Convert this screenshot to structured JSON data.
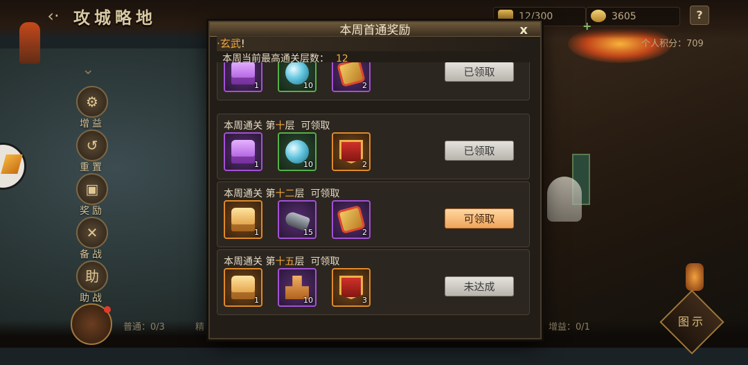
{
  "header": {
    "title": "攻城略地",
    "back_icon": "‹·",
    "resource_1": "12/300",
    "resource_2": "3605",
    "help_label": "?",
    "score": "个人积分：709"
  },
  "side_menu": [
    {
      "label": "增益",
      "icon": "gear-icon"
    },
    {
      "label": "重置",
      "icon": "reset-icon"
    },
    {
      "label": "奖励",
      "icon": "gift-icon"
    },
    {
      "label": "备战",
      "icon": "swords-icon"
    },
    {
      "label": "助战",
      "icon": "assist-icon",
      "glyph": "助"
    }
  ],
  "bottom": {
    "status_normal": "普通：0/3",
    "status_elite": "精",
    "status_buff": "增益：0/1",
    "map_button": "图示"
  },
  "modal": {
    "title": "本周首通奖励",
    "close": "x",
    "notice_highlight": "·玄武",
    "notice_tail": "!",
    "best_label": "本周当前最高通关层数：",
    "best_value": "12",
    "rows": [
      {
        "prefix": "",
        "floor": "",
        "suffix": "",
        "items": [
          {
            "kind": "chest-purple",
            "rarity": "purple",
            "count": "1"
          },
          {
            "kind": "orb",
            "rarity": "green",
            "count": "10"
          },
          {
            "kind": "token",
            "rarity": "purple",
            "count": "2"
          }
        ],
        "button": "已领取",
        "state": "done"
      },
      {
        "prefix": "本周通关 第",
        "floor": "十",
        "suffix": "层  可领取",
        "items": [
          {
            "kind": "chest-purple",
            "rarity": "purple",
            "count": "1"
          },
          {
            "kind": "orb",
            "rarity": "green",
            "count": "10"
          },
          {
            "kind": "banner",
            "rarity": "orange",
            "count": "2"
          }
        ],
        "button": "已领取",
        "state": "done"
      },
      {
        "prefix": "本周通关 第",
        "floor": "十二",
        "suffix": "层  可领取",
        "items": [
          {
            "kind": "chest-gold",
            "rarity": "orange",
            "count": "1"
          },
          {
            "kind": "cannon",
            "rarity": "purple",
            "count": "15"
          },
          {
            "kind": "token",
            "rarity": "purple",
            "count": "2"
          }
        ],
        "button": "可领取",
        "state": "ready"
      },
      {
        "prefix": "本周通关 第",
        "floor": "十五",
        "suffix": "层  可领取",
        "items": [
          {
            "kind": "chest-gold",
            "rarity": "orange",
            "count": "1"
          },
          {
            "kind": "seal",
            "rarity": "purple",
            "count": "10"
          },
          {
            "kind": "banner",
            "rarity": "orange",
            "count": "3"
          }
        ],
        "button": "未达成",
        "state": "locked"
      }
    ]
  },
  "colors": {
    "highlight": "#f2a63c",
    "ready_button": "#f0a45a",
    "done_button": "#b8b5ad"
  }
}
